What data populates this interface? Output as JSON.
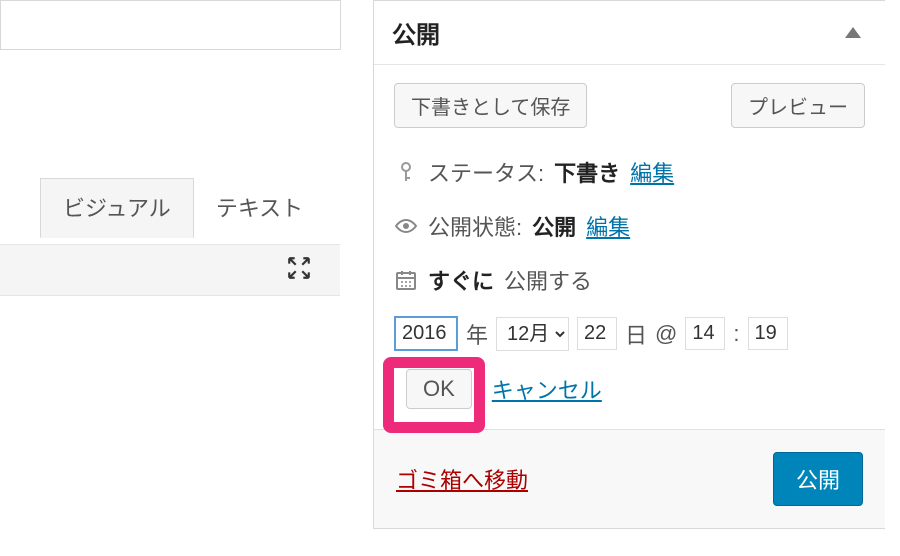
{
  "editor": {
    "tabs": {
      "visual": "ビジュアル",
      "text": "テキスト"
    }
  },
  "publish": {
    "title": "公開",
    "save_draft": "下書きとして保存",
    "preview": "プレビュー",
    "status_label": "ステータス:",
    "status_value": "下書き",
    "visibility_label": "公開状態:",
    "visibility_value": "公開",
    "edit": "編集",
    "schedule_prefix": "すぐに",
    "schedule_suffix": "公開する",
    "year": "2016",
    "year_unit": "年",
    "month": "12月",
    "day": "22",
    "day_unit": "日",
    "at": "@",
    "hour": "14",
    "colon": ":",
    "minute": "19",
    "ok": "OK",
    "cancel": "キャンセル",
    "trash": "ゴミ箱へ移動",
    "publish_btn": "公開"
  }
}
